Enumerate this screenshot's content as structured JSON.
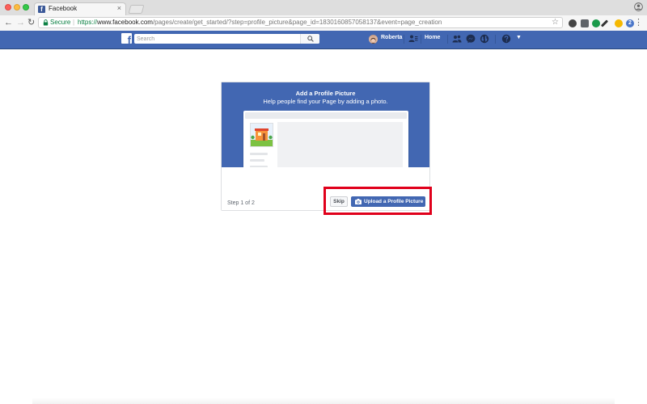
{
  "browser": {
    "tab": {
      "title": "Facebook",
      "close_glyph": "×",
      "favicon": "facebook-favicon"
    },
    "nav": {
      "back": "←",
      "forward": "→",
      "reload": "↻"
    },
    "address_bar": {
      "secure_label": "Secure",
      "separator": "|",
      "url_scheme": "https://",
      "url_host": "www.facebook.com",
      "url_path": "/pages/create/get_started/?step=profile_picture&page_id=1830160857058137&event=page_creation"
    },
    "bookmark_glyph": "☆",
    "extensions": [
      {
        "icon": "dark-extension-icon",
        "color": "#444444",
        "glyph": ""
      },
      {
        "icon": "pocket-extension-icon",
        "color": "#5f6368",
        "glyph": ""
      },
      {
        "icon": "green-extension-icon",
        "color": "#1a9a4a",
        "glyph": ""
      },
      {
        "icon": "eyedropper-extension-icon",
        "color": "#333333",
        "glyph": ""
      },
      {
        "icon": "emoji-extension-icon",
        "color": "#f5b800",
        "glyph": ""
      },
      {
        "icon": "blue-badge-extension-icon",
        "color": "#4a76c9",
        "glyph": "2"
      }
    ],
    "menu_glyph": "⋮"
  },
  "fb_header": {
    "search_placeholder": "Search",
    "user_name": "Roberta",
    "home_label": "Home",
    "caret_glyph": "▼",
    "brand_color": "#4267b2"
  },
  "card": {
    "title": "Add a Profile Picture",
    "subtitle": "Help people find your Page by adding a photo.",
    "step_text": "Step 1 of 2",
    "skip_label": "Skip",
    "upload_label": "Upload a Profile Picture"
  },
  "annotation": {
    "highlight_color": "#e0001b"
  }
}
